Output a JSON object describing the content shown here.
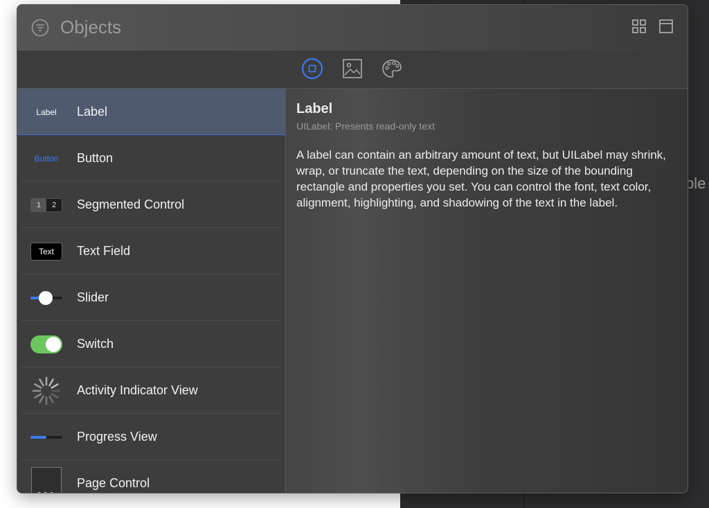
{
  "background": {
    "partial_text": "ble"
  },
  "header": {
    "title": "Objects"
  },
  "tabs": [
    {
      "name": "objects",
      "icon": "square-in-circle-icon",
      "selected": true
    },
    {
      "name": "media",
      "icon": "image-icon",
      "selected": false
    },
    {
      "name": "colors",
      "icon": "palette-icon",
      "selected": false
    }
  ],
  "library": {
    "items": [
      {
        "label": "Label",
        "icon_text": "Label",
        "selected": true
      },
      {
        "label": "Button",
        "icon_text": "Button"
      },
      {
        "label": "Segmented Control",
        "icon_seg_1": "1",
        "icon_seg_2": "2"
      },
      {
        "label": "Text Field",
        "icon_text": "Text"
      },
      {
        "label": "Slider",
        "slider_value": 0.4
      },
      {
        "label": "Switch",
        "switch_on": true
      },
      {
        "label": "Activity Indicator View"
      },
      {
        "label": "Progress View",
        "progress_value": 0.5
      },
      {
        "label": "Page Control"
      }
    ]
  },
  "detail": {
    "title": "Label",
    "subtitle": "UILabel: Presents read-only text",
    "description": "A label can contain an arbitrary amount of text, but UILabel may shrink, wrap, or truncate the text, depending on the size of the bounding rectangle and properties you set. You can control the font, text color, alignment, highlighting, and shadowing of the text in the label."
  },
  "colors": {
    "accent": "#3a7bf2",
    "switch_on": "#6cc760",
    "selected_row": "#4f5a6e"
  }
}
